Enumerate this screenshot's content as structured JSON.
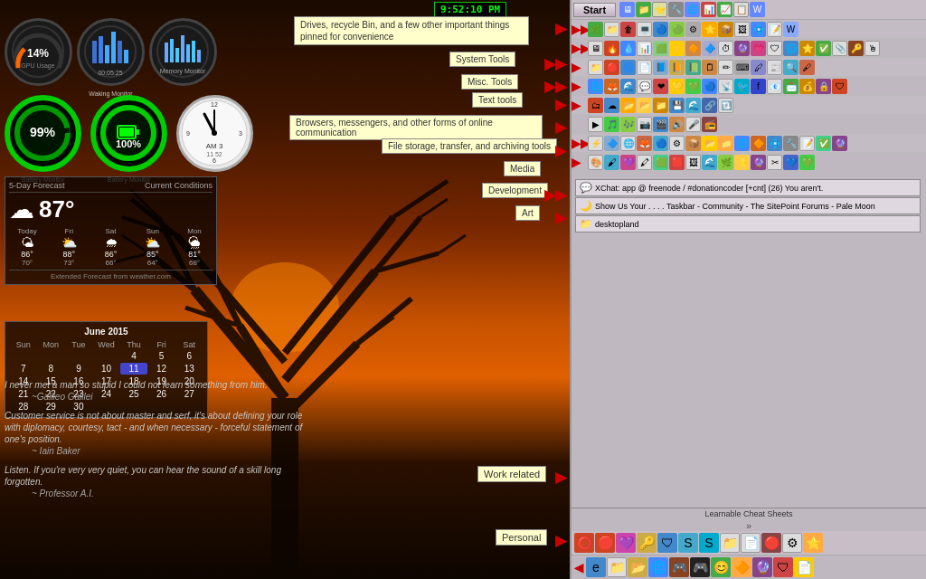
{
  "clock": {
    "time": "9:52:10 PM"
  },
  "desktop": {
    "background": "sunset tree silhouette"
  },
  "gauges": {
    "row1": [
      {
        "label": "GPU Usage",
        "value": "14%",
        "color": "#ff6600"
      },
      {
        "label": "Waking Monitor",
        "value": "00:05:25"
      },
      {
        "label": "Memory Monitor",
        "value": ""
      }
    ],
    "row2": [
      {
        "label": "99%",
        "sublabel": "Battery Monitor",
        "type": "green-ring"
      },
      {
        "label": "100%",
        "sublabel": "Battery Monitor",
        "type": "battery"
      },
      {
        "label": "clock",
        "time": "11:52 AM 3",
        "sublabel": "",
        "type": "analog-clock"
      }
    ]
  },
  "weather": {
    "temp": "87°",
    "icon": "☁",
    "forecast_label": "5-Day Forecast",
    "conditions_label": "Current Conditions",
    "days": [
      {
        "name": "Today",
        "high": "86°",
        "low": "70°",
        "icon": "🌤"
      },
      {
        "name": "Fri",
        "high": "88°",
        "low": "73°",
        "icon": "⛅"
      },
      {
        "name": "Sat",
        "high": "86°",
        "low": "66°",
        "icon": "🌧"
      },
      {
        "name": "Sun",
        "high": "85°",
        "low": "64°",
        "icon": "⛅"
      },
      {
        "name": "Mon",
        "high": "81°",
        "low": "68°",
        "icon": "🌦"
      }
    ],
    "footer": "Extended Forecast from weather.com"
  },
  "calendar": {
    "title": "June 2015",
    "day_names": [
      "Sun",
      "Mon",
      "Tue",
      "Wed",
      "Thu",
      "Fri",
      "Sat"
    ],
    "weeks": [
      [
        "",
        "",
        "",
        "",
        "4",
        "5",
        "6"
      ],
      [
        "7",
        "8",
        "9",
        "10",
        "11",
        "12",
        "13"
      ],
      [
        "14",
        "15",
        "16",
        "17",
        "18",
        "19",
        "20"
      ],
      [
        "21",
        "22",
        "23",
        "24",
        "25",
        "26",
        "27"
      ],
      [
        "28",
        "29",
        "30",
        "",
        "",
        "",
        ""
      ]
    ],
    "today": "11"
  },
  "quotes": [
    {
      "text": "I never met a man so stupid I could not learn something from him.",
      "author": "~Galileo Galilei"
    },
    {
      "text": "Customer service is not about master and serf, it's about defining your role with diplomacy, courtesy, tact - and when necessary - forceful statement of one's position.",
      "author": "~ Iain Baker"
    },
    {
      "text": "Listen. If you're very very quiet, you can hear the sound of a skill long forgotten.",
      "author": "~ Professor A.I."
    }
  ],
  "sections": {
    "tooltip1": "Drives, recycle Bin, and a few other important things pinned for convenience",
    "system_tools": "System Tools",
    "misc_tools": "Misc. Tools",
    "text_tools": "Text tools",
    "browsers": "Browsers, messengers, and other forms of online communication",
    "file_storage": "File storage, transfer, and archiving tools",
    "media": "Media",
    "development": "Development",
    "art": "Art",
    "work_related": "Work related",
    "personal": "Personal"
  },
  "open_windows": [
    {
      "icon": "💬",
      "label": "XChat: app @ freenode / #donationcoder [+cnt] (26) You aren't."
    },
    {
      "icon": "🌙",
      "label": "Show Us Your . . . . Taskbar - Community - The SitePoint Forums - Pale Moon"
    },
    {
      "icon": "📁",
      "label": "desktopland"
    }
  ],
  "taskbar": {
    "start_label": "Start",
    "learnable_label": "Learnable Cheat Sheets",
    "expand": "»"
  },
  "panel_rows": [
    {
      "id": "row1",
      "has_arrow": true,
      "arrow_double": true,
      "icon_count": 15
    },
    {
      "id": "row2",
      "has_arrow": true,
      "icon_count": 18
    },
    {
      "id": "row3",
      "has_arrow": true,
      "icon_count": 14
    },
    {
      "id": "row4",
      "has_arrow": true,
      "icon_count": 16
    },
    {
      "id": "row5",
      "has_arrow": true,
      "icon_count": 15
    },
    {
      "id": "row6",
      "has_arrow": false,
      "icon_count": 8
    },
    {
      "id": "row7",
      "has_arrow": true,
      "icon_count": 16
    },
    {
      "id": "row8",
      "has_arrow": true,
      "icon_count": 14
    }
  ]
}
